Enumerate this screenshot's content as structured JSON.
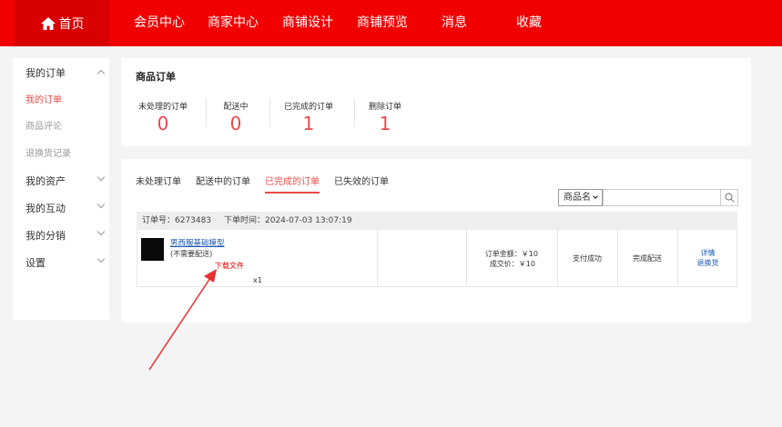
{
  "nav": {
    "home": "首页",
    "items": [
      "会员中心",
      "商家中心",
      "商铺设计",
      "商铺预览",
      "消息",
      "收藏"
    ]
  },
  "sidebar": {
    "my_orders": "我的订单",
    "sub_items": [
      "我的订单",
      "商品评论",
      "退换货记录"
    ],
    "groups": [
      "我的资产",
      "我的互动",
      "我的分销",
      "设置"
    ]
  },
  "summary": {
    "title": "商品订单",
    "stats": [
      {
        "label": "未处理的订单",
        "value": "0"
      },
      {
        "label": "配送中",
        "value": "0"
      },
      {
        "label": "已完成的订单",
        "value": "1"
      },
      {
        "label": "删除订单",
        "value": "1"
      }
    ]
  },
  "tabs": [
    "未处理订单",
    "配送中的订单",
    "已完成的订单",
    "已失效的订单"
  ],
  "search": {
    "select_value": "商品名"
  },
  "order": {
    "number": "订单号：6273483",
    "time": "下单时间：2024-07-03 13:07:19",
    "product_name": "男西服基础模型",
    "shipping_note": "(不需要配送)",
    "download": "下载文件",
    "quantity": "x1",
    "total": "订单金额：￥10",
    "deal_price": "成交价：￥10",
    "payment_status": "支付成功",
    "delivery_status": "完成配送",
    "detail": "详情",
    "return": "退换货"
  },
  "colors": {
    "nav": "#f00000",
    "home_bg": "#d80000",
    "accent": "#e84a4a",
    "link": "#1a56b0"
  }
}
